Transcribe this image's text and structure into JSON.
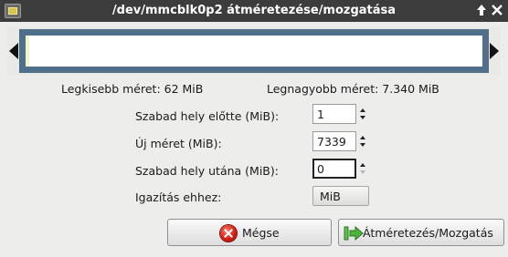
{
  "window": {
    "title": "/dev/mmcblk0p2 átméretezése/mozgatása",
    "controls": {
      "pin_glyph": "▲",
      "close_glyph": "✕"
    }
  },
  "sizes": {
    "min_label": "Legkisebb méret: 62 MiB",
    "max_label": "Legnagyobb méret: 7.340 MiB"
  },
  "form": {
    "free_before": {
      "label": "Szabad hely előtte (MiB):",
      "value": "1"
    },
    "new_size": {
      "label": "Új méret (MiB):",
      "value": "7339"
    },
    "free_after": {
      "label": "Szabad hely utána (MiB):",
      "value": "0"
    },
    "align": {
      "label": "Igazítás ehhez:",
      "value": "MiB"
    }
  },
  "buttons": {
    "cancel_label": "Mégse",
    "resize_label": "Átméretezés/Mozgatás"
  },
  "colors": {
    "partition_border": "#4f6f8b",
    "titlebar": "#3c3c3c",
    "cancel_icon": "#d11a0e",
    "resize_icon": "#3aa53a"
  }
}
